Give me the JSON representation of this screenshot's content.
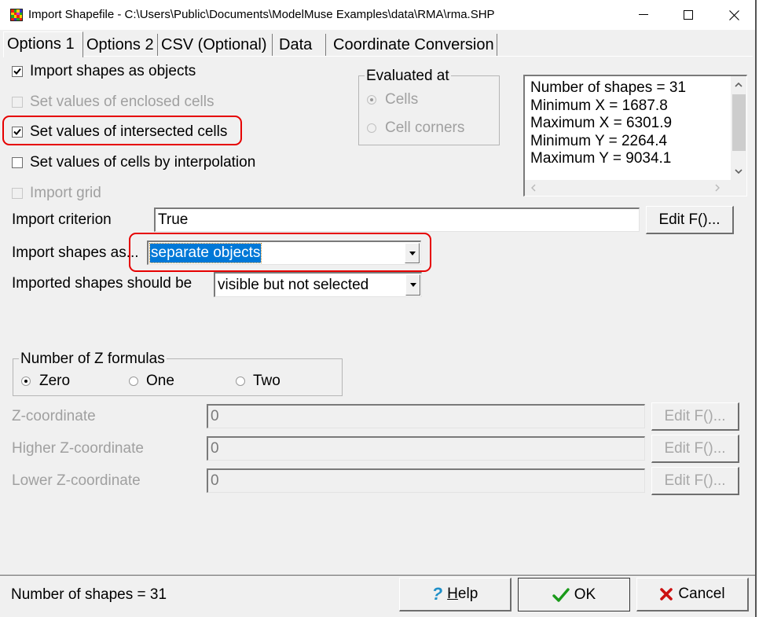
{
  "window": {
    "title": "Import Shapefile - C:\\Users\\Public\\Documents\\ModelMuse Examples\\data\\RMA\\rma.SHP",
    "app_icon": "modelmuse-app-icon",
    "controls": {
      "minimize": "minimize-icon",
      "maximize": "maximize-icon",
      "close": "close-icon"
    }
  },
  "tabs": [
    {
      "label": "Options 1",
      "active": true
    },
    {
      "label": "Options 2",
      "active": false
    },
    {
      "label": "CSV (Optional)",
      "active": false
    },
    {
      "label": "Data",
      "active": false
    },
    {
      "label": "Coordinate Conversion",
      "active": false
    }
  ],
  "options": {
    "checkboxes": [
      {
        "label": "Import shapes as objects",
        "checked": true,
        "enabled": true
      },
      {
        "label": "Set values of enclosed cells",
        "checked": false,
        "enabled": false
      },
      {
        "label": "Set values of intersected cells",
        "checked": true,
        "enabled": true,
        "highlighted": true
      },
      {
        "label": "Set values of cells by interpolation",
        "checked": false,
        "enabled": true
      },
      {
        "label": "Import grid",
        "checked": false,
        "enabled": false
      }
    ],
    "evaluated_at": {
      "title": "Evaluated at",
      "options": [
        {
          "label": "Cells",
          "selected": true,
          "enabled": false
        },
        {
          "label": "Cell corners",
          "selected": false,
          "enabled": false
        }
      ]
    },
    "summary_lines": [
      "Number of shapes = 31",
      "Minimum X = 1687.8",
      "Maximum X = 6301.9",
      "Minimum Y = 2264.4",
      "Maximum Y = 9034.1"
    ],
    "import_criterion": {
      "label": "Import criterion",
      "value": "True",
      "button": "Edit F()..."
    },
    "import_shapes_as": {
      "label": "Import shapes as...",
      "value": "separate objects",
      "highlighted": true
    },
    "imported_shapes_should_be": {
      "label": "Imported shapes should be",
      "value": "visible but not selected"
    },
    "z_formulas": {
      "title": "Number of Z formulas",
      "options": [
        {
          "label": "Zero",
          "selected": true
        },
        {
          "label": "One",
          "selected": false
        },
        {
          "label": "Two",
          "selected": false
        }
      ]
    },
    "z_fields": [
      {
        "label": "Z-coordinate",
        "value": "0",
        "button": "Edit F()...",
        "enabled": false
      },
      {
        "label": "Higher Z-coordinate",
        "value": "0",
        "button": "Edit F()...",
        "enabled": false
      },
      {
        "label": "Lower Z-coordinate",
        "value": "0",
        "button": "Edit F()...",
        "enabled": false
      }
    ]
  },
  "footer": {
    "status": "Number of shapes = 31",
    "help": {
      "mnemonic": "H",
      "rest": "elp"
    },
    "ok": "OK",
    "cancel": "Cancel",
    "colors": {
      "help_icon": "#1e8fc8",
      "ok_icon": "#1a9a1a",
      "cancel_icon": "#cc1111",
      "highlight": "#e60000",
      "selection": "#0078d7"
    }
  }
}
